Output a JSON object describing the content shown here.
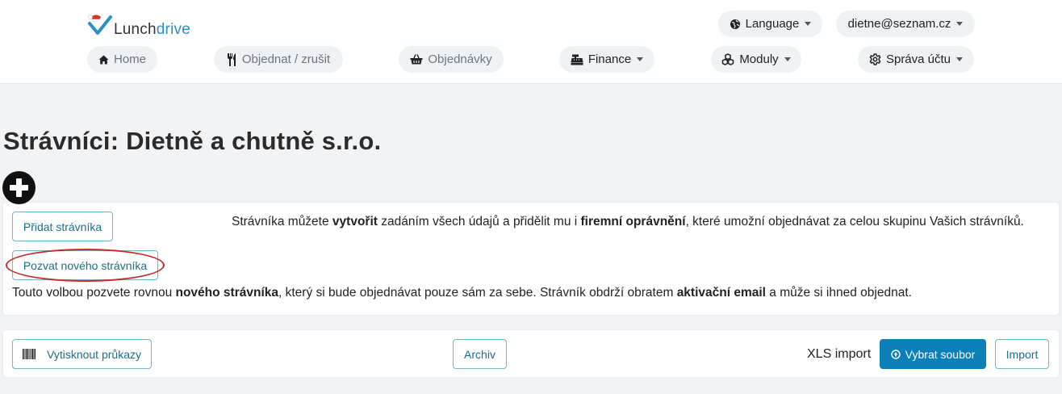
{
  "brand": {
    "part1": "Lunch",
    "part2": "drive"
  },
  "header": {
    "language_label": "Language",
    "user_email": "dietne@seznam.cz",
    "nav": {
      "home": "Home",
      "order": "Objednat / zrušit",
      "orders": "Objednávky",
      "finance": "Finance",
      "modules": "Moduly",
      "account": "Správa účtu"
    }
  },
  "page": {
    "title": "Strávníci: Dietně a chutně s.r.o."
  },
  "add_section": {
    "add_button": "Přidat strávníka",
    "add_desc": {
      "p1": "Strávníka můžete ",
      "b1": "vytvořit",
      "p2": " zadáním všech údajů a přidělit mu i ",
      "b2": "firemní oprávnění",
      "p3": ", které umožní objednávat za celou skupinu Vašich strávníků."
    },
    "invite_button": "Pozvat nového strávníka",
    "invite_desc": {
      "p1": "Touto volbou pozvete rovnou ",
      "b1": "nového strávníka",
      "p2": ", který si bude objednávat pouze sám za sebe. Strávník obdrží obratem ",
      "b2": "aktivační email",
      "p3": " a může si ihned objednat."
    }
  },
  "bottom_bar": {
    "print_cards": "Vytisknout průkazy",
    "archive": "Archiv",
    "xls_label": "XLS import",
    "choose_file": "Vybrat soubor",
    "import": "Import"
  },
  "colors": {
    "accent": "#0d7fb8",
    "outline_button_border": "#6fb7cc",
    "highlight_ellipse": "#c62b2b",
    "pill_bg": "#eef2f4",
    "page_bg": "#f2f3f5"
  },
  "icons": {
    "language": "globe-icon",
    "home": "home-icon",
    "order": "utensils-icon",
    "orders": "basket-icon",
    "finance": "cash-register-icon",
    "modules": "cubes-icon",
    "account": "gear-icon",
    "add": "plus-circle-icon",
    "print": "barcode-icon",
    "upload": "upload-circle-icon"
  }
}
